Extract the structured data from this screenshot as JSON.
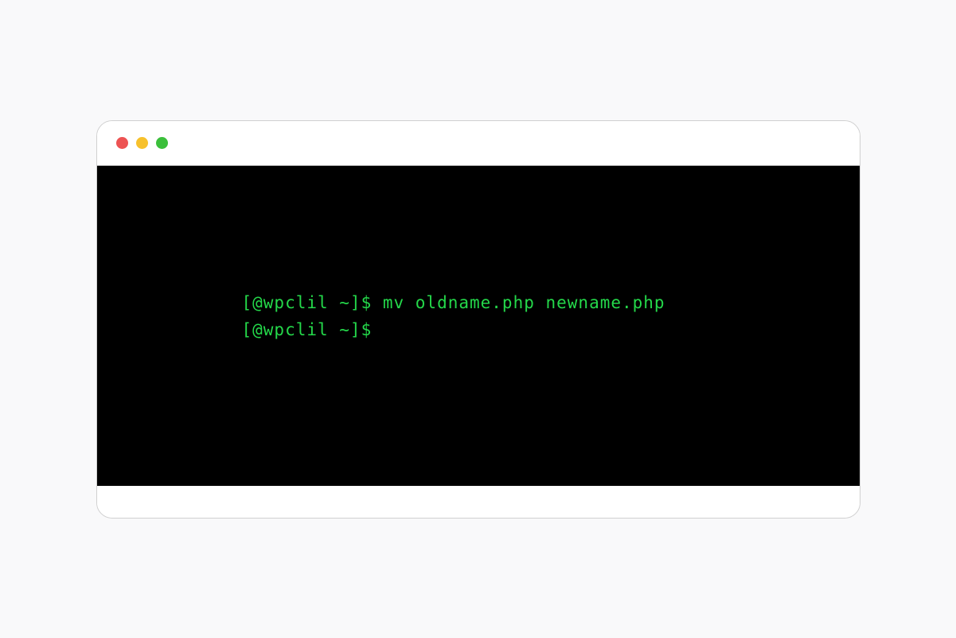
{
  "colors": {
    "close": "#ed5353",
    "minimize": "#f7c12c",
    "zoom": "#3bbf3b",
    "terminal_bg": "#000000",
    "terminal_fg": "#24d84a"
  },
  "terminal": {
    "line1": "[@wpclil ~]$ mv oldname.php newname.php",
    "line2": "[@wpclil ~]$"
  }
}
